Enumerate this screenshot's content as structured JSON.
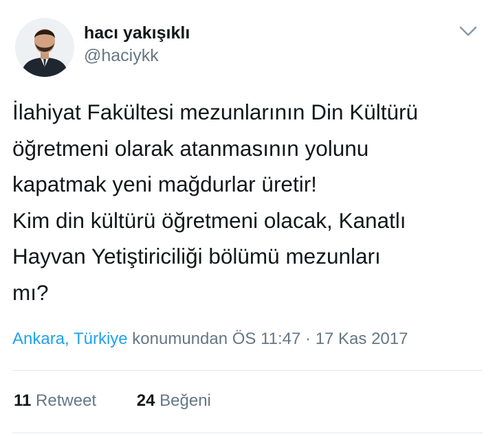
{
  "tweet": {
    "author": {
      "display_name": "hacı yakışıklı",
      "handle": "@haciykk"
    },
    "text_lines": [
      "İlahiyat Fakültesi mezunlarının Din Kültürü",
      "öğretmeni olarak atanmasının yolunu",
      "kapatmak yeni mağdurlar üretir!",
      "Kim din kültürü öğretmeni olacak, Kanatlı",
      "Hayvan Yetiştiriciliği bölümü mezunları",
      "mı?"
    ],
    "meta": {
      "location": "Ankara, Türkiye",
      "location_suffix": " konumundan ",
      "time": "ÖS 11:47",
      "separator": " · ",
      "date": "17 Kas 2017"
    },
    "stats": {
      "retweets_count": "11",
      "retweets_label": "Retweet",
      "likes_count": "24",
      "likes_label": "Beğeni"
    }
  },
  "icons": {
    "menu": "chevron-down-icon"
  },
  "colors": {
    "text_primary": "#14171a",
    "text_secondary": "#657786",
    "link": "#1da1f2",
    "divider": "#e1e8ed"
  }
}
